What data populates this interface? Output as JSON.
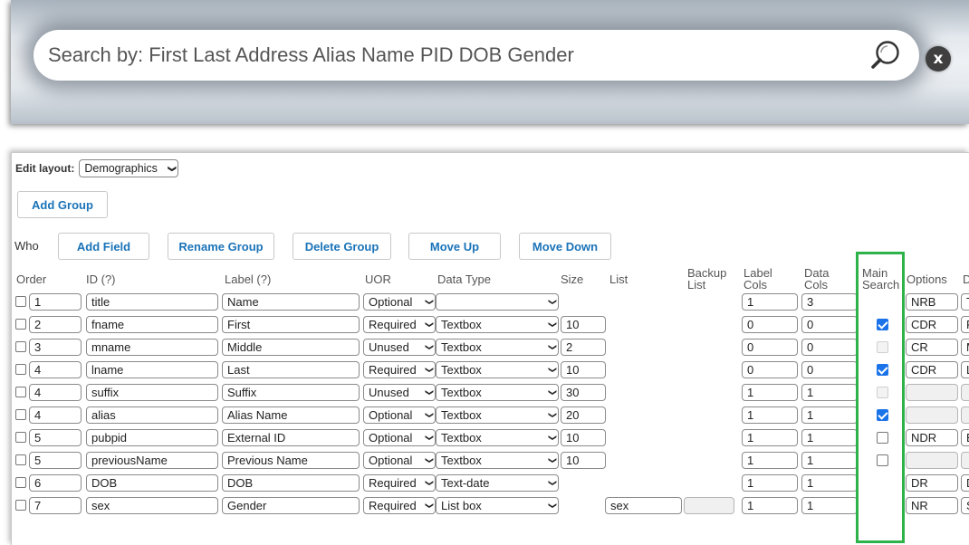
{
  "search": {
    "placeholder": "Search by: First Last Address Alias Name PID DOB Gender",
    "icon": "magnifier-icon",
    "clear_label": "x"
  },
  "editor": {
    "edit_layout_label": "Edit layout:",
    "layout_selected": "Demographics",
    "add_group": "Add Group",
    "who_label": "Who",
    "buttons": {
      "add_field": "Add Field",
      "rename_group": "Rename Group",
      "delete_group": "Delete Group",
      "move_up": "Move Up",
      "move_down": "Move Down"
    },
    "headers": {
      "order": "Order",
      "id": "ID (?)",
      "label": "Label (?)",
      "uor": "UOR",
      "data_type": "Data Type",
      "size": "Size",
      "list": "List",
      "backup_list_1": "Backup",
      "backup_list_2": "List",
      "label_cols_1": "Label",
      "label_cols_2": "Cols",
      "data_cols_1": "Data",
      "data_cols_2": "Cols",
      "main_search_1": "Main",
      "main_search_2": "Search",
      "options": "Options",
      "next": "D"
    },
    "rows": [
      {
        "order": "1",
        "id": "title",
        "label": "Name",
        "uor": "Optional",
        "data_type": "",
        "size": "",
        "list": "",
        "backup": "",
        "label_cols": "1",
        "data_cols": "3",
        "main_search": "none",
        "options": "NRB",
        "next": "T"
      },
      {
        "order": "2",
        "id": "fname",
        "label": "First",
        "uor": "Required",
        "data_type": "Textbox",
        "size": "10",
        "list": "",
        "backup": "",
        "label_cols": "0",
        "data_cols": "0",
        "main_search": "checked-disabled",
        "options": "CDR",
        "next": "F"
      },
      {
        "order": "3",
        "id": "mname",
        "label": "Middle",
        "uor": "Unused",
        "data_type": "Textbox",
        "size": "2",
        "list": "",
        "backup": "",
        "label_cols": "0",
        "data_cols": "0",
        "main_search": "disabled",
        "options": "CR",
        "next": "M"
      },
      {
        "order": "4",
        "id": "lname",
        "label": "Last",
        "uor": "Required",
        "data_type": "Textbox",
        "size": "10",
        "list": "",
        "backup": "",
        "label_cols": "0",
        "data_cols": "0",
        "main_search": "checked-disabled",
        "options": "CDR",
        "next": "L"
      },
      {
        "order": "4",
        "id": "suffix",
        "label": "Suffix",
        "uor": "Unused",
        "data_type": "Textbox",
        "size": "30",
        "list": "",
        "backup": "",
        "label_cols": "1",
        "data_cols": "1",
        "main_search": "disabled",
        "options": "",
        "next": ""
      },
      {
        "order": "4",
        "id": "alias",
        "label": "Alias Name",
        "uor": "Optional",
        "data_type": "Textbox",
        "size": "20",
        "list": "",
        "backup": "",
        "label_cols": "1",
        "data_cols": "1",
        "main_search": "checked",
        "options": "",
        "next": ""
      },
      {
        "order": "5",
        "id": "pubpid",
        "label": "External ID",
        "uor": "Optional",
        "data_type": "Textbox",
        "size": "10",
        "list": "",
        "backup": "",
        "label_cols": "1",
        "data_cols": "1",
        "main_search": "unchecked",
        "options": "NDR",
        "next": "E"
      },
      {
        "order": "5",
        "id": "previousName",
        "label": "Previous Name",
        "uor": "Optional",
        "data_type": "Textbox",
        "size": "10",
        "list": "",
        "backup": "",
        "label_cols": "1",
        "data_cols": "1",
        "main_search": "unchecked",
        "options": "",
        "next": ""
      },
      {
        "order": "6",
        "id": "DOB",
        "label": "DOB",
        "uor": "Required",
        "data_type": "Text-date",
        "size": "",
        "list": "",
        "backup": "",
        "label_cols": "1",
        "data_cols": "1",
        "main_search": "none",
        "options": "DR",
        "next": "D"
      },
      {
        "order": "7",
        "id": "sex",
        "label": "Gender",
        "uor": "Required",
        "data_type": "List box",
        "size": "",
        "list": "sex",
        "backup": "",
        "label_cols": "1",
        "data_cols": "1",
        "main_search": "none",
        "options": "NR",
        "next": "S"
      }
    ],
    "highlight_color": "#2db34a",
    "link_color": "#1a73b8"
  }
}
